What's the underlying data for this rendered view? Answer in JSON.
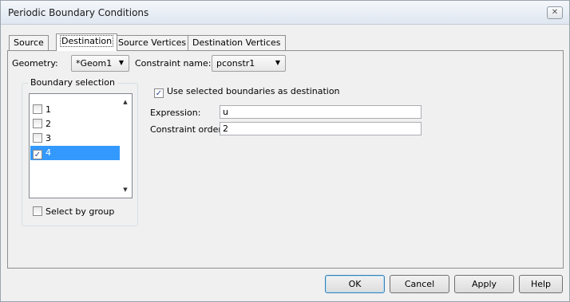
{
  "window": {
    "title": "Periodic Boundary Conditions",
    "close_glyph": "✕"
  },
  "tabs": [
    {
      "label": "Source",
      "active": false
    },
    {
      "label": "Destination",
      "active": true
    },
    {
      "label": "Source Vertices",
      "active": false
    },
    {
      "label": "Destination Vertices",
      "active": false
    }
  ],
  "geometry": {
    "label": "Geometry:",
    "value": "*Geom1"
  },
  "constraint_name": {
    "label": "Constraint name:",
    "value": "pconstr1"
  },
  "boundary_selection": {
    "title": "Boundary selection",
    "items": [
      {
        "label": "1",
        "checked": false,
        "selected": false
      },
      {
        "label": "2",
        "checked": false,
        "selected": false
      },
      {
        "label": "3",
        "checked": false,
        "selected": false
      },
      {
        "label": "4",
        "checked": true,
        "selected": true
      }
    ],
    "select_by_group": {
      "label": "Select by group",
      "checked": false
    }
  },
  "use_selected": {
    "label": "Use selected boundaries as destination",
    "checked": true
  },
  "expression": {
    "label": "Expression:",
    "value": "u"
  },
  "constraint_order": {
    "label": "Constraint order:",
    "value": "2"
  },
  "buttons": {
    "ok": "OK",
    "cancel": "Cancel",
    "apply": "Apply",
    "help": "Help"
  },
  "glyphs": {
    "check": "✓",
    "dropdown": "▼",
    "scroll_up": "▲",
    "scroll_down": "▼"
  },
  "colors": {
    "selection": "#3399ff",
    "dialog_bg": "#f0f0f0"
  }
}
